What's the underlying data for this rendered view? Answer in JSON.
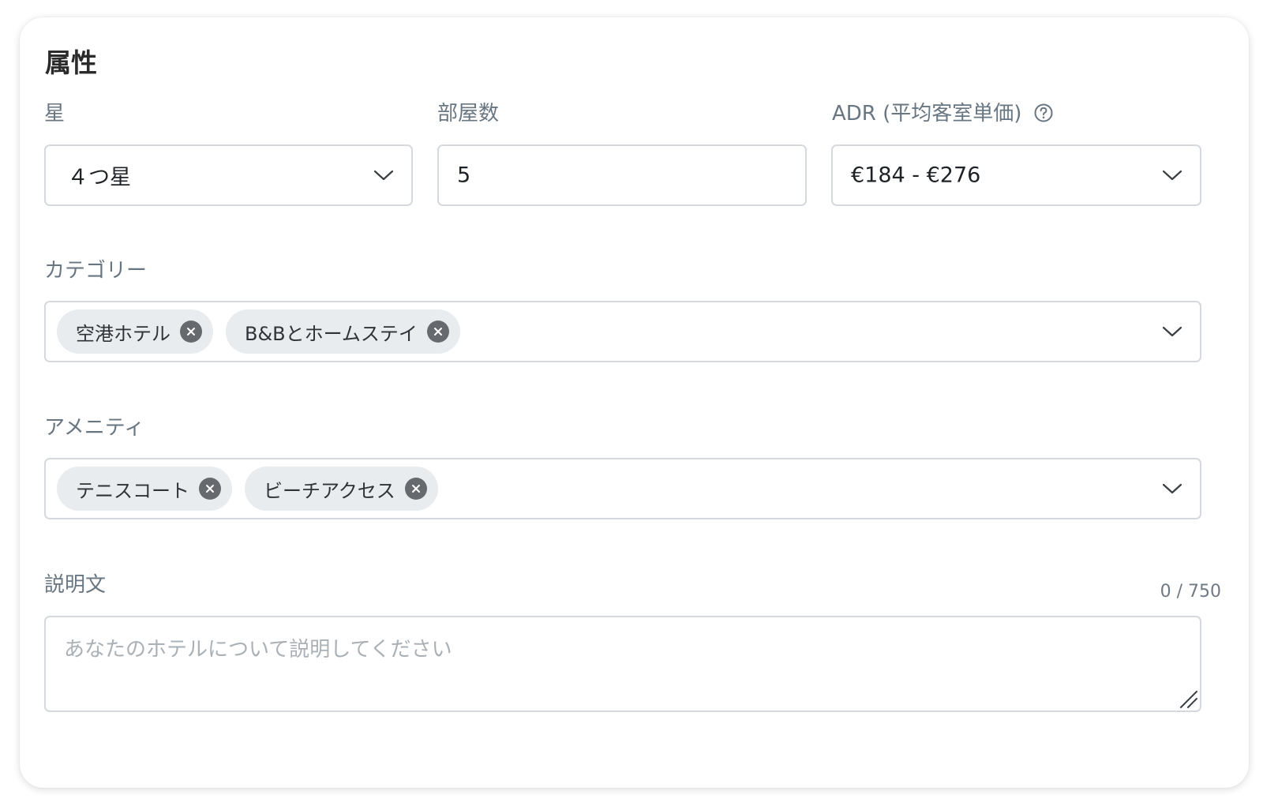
{
  "section": {
    "title": "属性"
  },
  "stars": {
    "label": "星",
    "value": "４つ星"
  },
  "rooms": {
    "label": "部屋数",
    "value": "5"
  },
  "adr": {
    "label": "ADR (平均客室単価)",
    "value": "€184 - €276"
  },
  "categories": {
    "label": "カテゴリー",
    "chips": [
      "空港ホテル",
      "B&Bとホームステイ"
    ]
  },
  "amenities": {
    "label": "アメニティ",
    "chips": [
      "テニスコート",
      "ビーチアクセス"
    ]
  },
  "description": {
    "label": "説明文",
    "counter": "0 / 750",
    "placeholder": "あなたのホテルについて説明してください",
    "value": ""
  },
  "icons": {
    "dropdown": "chevron-down-icon",
    "help": "help-circle-icon",
    "remove": "close-circle-icon",
    "resize": "resize-grip-icon"
  },
  "colors": {
    "label": "#687682",
    "border": "#d5d9de",
    "chip_bg": "#e8ecef",
    "chip_remove_bg": "#666a6e",
    "placeholder": "#a9b0b6",
    "title": "#2b2b2b"
  }
}
